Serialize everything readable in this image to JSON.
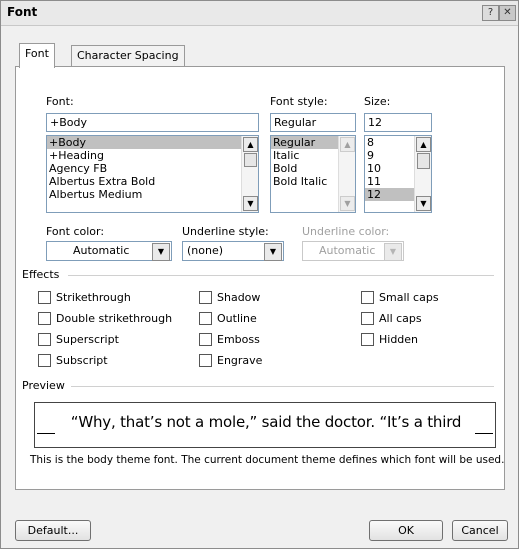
{
  "window": {
    "title": "Font"
  },
  "titlebar": {
    "help_glyph": "?",
    "close_glyph": "✕"
  },
  "tabs": [
    {
      "label": "Font"
    },
    {
      "label": "Character Spacing"
    }
  ],
  "font_section": {
    "font_label": "Font:",
    "font_value": "+Body",
    "font_list": [
      "+Body",
      "+Heading",
      "Agency FB",
      "Albertus Extra Bold",
      "Albertus Medium"
    ],
    "font_selected": "+Body",
    "style_label": "Font style:",
    "style_value": "Regular",
    "style_list": [
      "Regular",
      "Italic",
      "Bold",
      "Bold Italic"
    ],
    "style_selected": "Regular",
    "size_label": "Size:",
    "size_value": "12",
    "size_list": [
      "8",
      "9",
      "10",
      "11",
      "12"
    ],
    "size_selected": "12"
  },
  "colors_row": {
    "font_color_label": "Font color:",
    "font_color_value": "Automatic",
    "underline_style_label": "Underline style:",
    "underline_style_value": "(none)",
    "underline_color_label": "Underline color:",
    "underline_color_value": "Automatic"
  },
  "effects": {
    "legend": "Effects",
    "col1": [
      "Strikethrough",
      "Double strikethrough",
      "Superscript",
      "Subscript"
    ],
    "col2": [
      "Shadow",
      "Outline",
      "Emboss",
      "Engrave"
    ],
    "col3": [
      "Small caps",
      "All caps",
      "Hidden"
    ]
  },
  "preview": {
    "legend": "Preview",
    "sample_text": "“Why, that’s not a mole,” said the doctor. “It’s a third",
    "description": "This is the body theme font. The current document theme defines which font will be used."
  },
  "buttons": {
    "default_label": "Default...",
    "ok_label": "OK",
    "cancel_label": "Cancel"
  },
  "icons": {
    "scroll_up": "▲",
    "scroll_down": "▼",
    "dropdown": "▼"
  }
}
